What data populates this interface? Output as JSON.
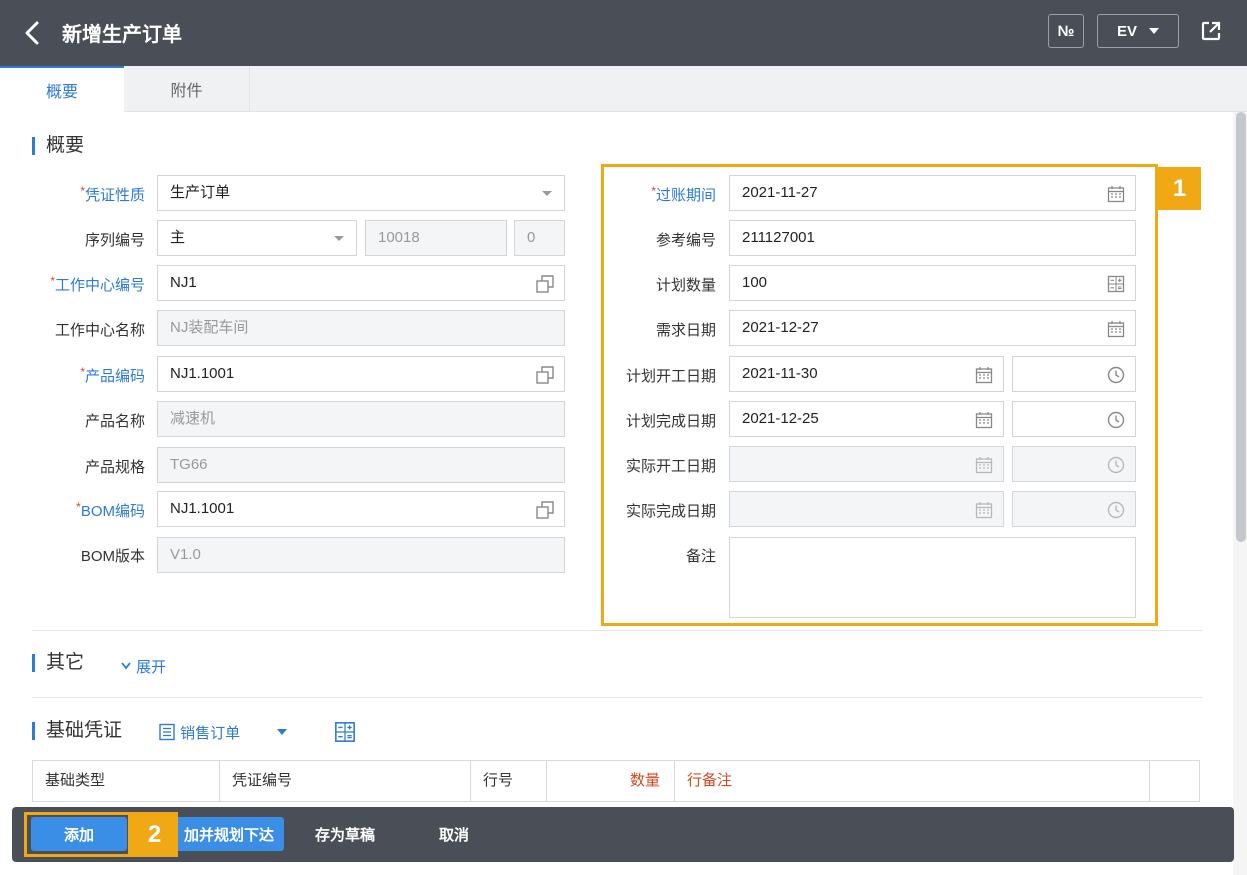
{
  "header": {
    "title": "新增生产订单",
    "number_label": "№",
    "lang_label": "EV"
  },
  "tabs": [
    {
      "label": "概要"
    },
    {
      "label": "附件"
    }
  ],
  "sections": {
    "overview": "概要",
    "other": "其它",
    "other_expand": "展开",
    "base_voucher": "基础凭证",
    "base_voucher_link": "销售订单"
  },
  "left_form": {
    "voucher_type": {
      "label": "凭证性质",
      "value": "生产订单"
    },
    "serial": {
      "label": "序列编号",
      "value": "主",
      "number": "10018",
      "suffix": "0"
    },
    "wc_code": {
      "label": "工作中心编号",
      "value": "NJ1"
    },
    "wc_name": {
      "label": "工作中心名称",
      "value": "NJ装配车间"
    },
    "product_code": {
      "label": "产品编码",
      "value": "NJ1.1001"
    },
    "product_name": {
      "label": "产品名称",
      "value": "减速机"
    },
    "product_spec": {
      "label": "产品规格",
      "value": "TG66"
    },
    "bom_code": {
      "label": "BOM编码",
      "value": "NJ1.1001"
    },
    "bom_version": {
      "label": "BOM版本",
      "value": "V1.0"
    }
  },
  "right_form": {
    "posting_period": {
      "label": "过账期间",
      "value": "2021-11-27"
    },
    "reference_no": {
      "label": "参考编号",
      "value": "211127001"
    },
    "planned_qty": {
      "label": "计划数量",
      "value": "100"
    },
    "demand_date": {
      "label": "需求日期",
      "value": "2021-12-27"
    },
    "plan_start": {
      "label": "计划开工日期",
      "value": "2021-11-30"
    },
    "plan_finish": {
      "label": "计划完成日期",
      "value": "2021-12-25"
    },
    "actual_start": {
      "label": "实际开工日期"
    },
    "actual_finish": {
      "label": "实际完成日期"
    },
    "remark": {
      "label": "备注"
    }
  },
  "table": {
    "columns": [
      "基础类型",
      "凭证编号",
      "行号",
      "数量",
      "行备注"
    ]
  },
  "footer": {
    "add": "添加",
    "add_plan_release": "添加并规划下达",
    "add_plan_release_visible": "加并规划下达",
    "save_draft": "存为草稿",
    "cancel": "取消"
  },
  "callouts": {
    "one": "1",
    "two": "2"
  },
  "colors": {
    "header_bg": "#4a4f57",
    "accent": "#2e7bd6",
    "highlight": "#f0a815",
    "required_star": "#e03c3c"
  }
}
